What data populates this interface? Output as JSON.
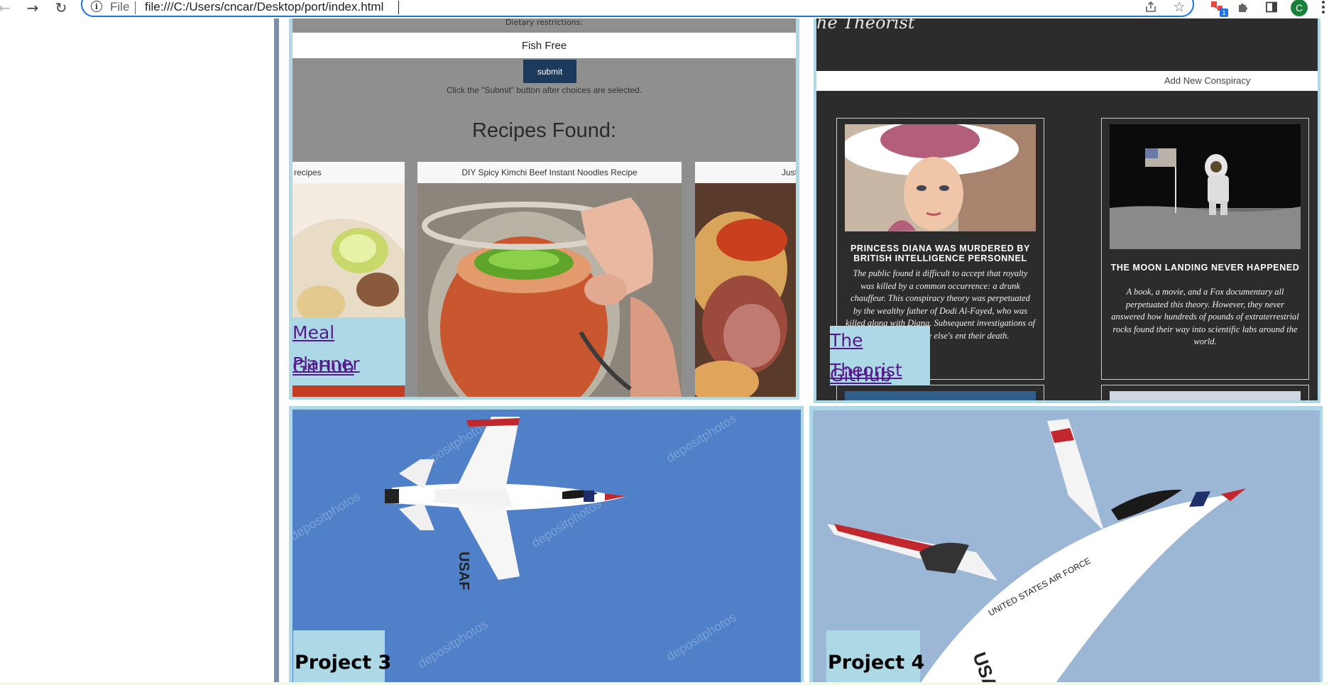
{
  "browser": {
    "scheme_label": "File",
    "url": "file:///C:/Users/cncar/Desktop/port/index.html",
    "extension_badge": "1",
    "profile_initial": "C",
    "icons": {
      "back": "arrow-left-icon",
      "forward": "arrow-right-icon",
      "reload": "reload-icon",
      "info": "info-icon",
      "share": "share-icon",
      "bookmark": "star-icon",
      "extension": "extension-icon",
      "extensions_menu": "puzzle-icon",
      "side_panel": "side-panel-icon",
      "menu": "kebab-menu-icon"
    }
  },
  "projects": [
    {
      "name": "Meal Planner",
      "link_label": "Meal Planner",
      "github_label": "GitHub",
      "screenshot": {
        "restrictions_label": "Dietary restrictions:",
        "selected_option": "Fish Free",
        "submit_label": "submit",
        "hint": "Click the \"Submit\" button after choices are selected.",
        "heading": "Recipes Found:",
        "recipes": [
          {
            "title": "recipes"
          },
          {
            "title": "DIY Spicy Kimchi Beef Instant Noodles Recipe"
          },
          {
            "title": "Just"
          }
        ]
      }
    },
    {
      "name": "The Theorist",
      "link_label": "The Theorist",
      "github_label": "GitHub",
      "screenshot": {
        "title": "he Theorist",
        "add_button_label": "Add New Conspiracy",
        "cards": [
          {
            "heading": "PRINCESS DIANA WAS MURDERED BY BRITISH INTELLIGENCE PERSONNEL",
            "body": "The public found it difficult to accept that royalty was killed by a common occurrence: a drunk chauffeur. This conspiracy theory was perpetuated by the wealthy father of Dodi Al-Fayed, who was killed along with Diana. Subsequent investigations of any truth anyone else's ent their death."
          },
          {
            "heading": "THE MOON LANDING NEVER HAPPENED",
            "body": "A book, a movie, and a Fox documentary all perpetuated this theory. However, they never answered how hundreds of pounds of extraterrestrial rocks found their way into scientific labs around the world."
          }
        ]
      }
    },
    {
      "name": "Project 3",
      "label": "Project 3",
      "watermark": "depositphotos"
    },
    {
      "name": "Project 4",
      "label": "Project 4",
      "tail_text": "UNITED STATES AIR FORCE",
      "tail_code": "USAF"
    }
  ],
  "colors": {
    "card_background": "#add8e6",
    "link_color": "#551a8b",
    "divider": "#7f8fa9",
    "omnibox_focus": "#1a73e8"
  }
}
